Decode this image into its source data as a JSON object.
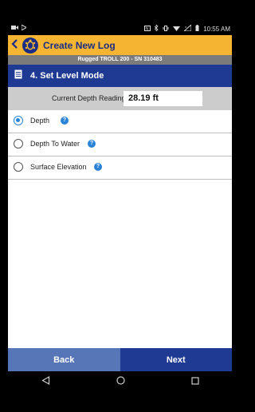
{
  "status_bar": {
    "time": "10:55 AM",
    "icons": [
      "video-icon",
      "play-icon",
      "nfc-icon",
      "bluetooth-icon",
      "vibrate-icon",
      "wifi-icon",
      "signal-icon",
      "battery-icon"
    ]
  },
  "app_bar": {
    "back_icon": "chevron-left-icon",
    "logo_icon": "turtle-logo-icon",
    "title": "Create New Log",
    "color": "#f5b431"
  },
  "device_bar": {
    "text": "Rugged TROLL 200 - SN 310483"
  },
  "step_bar": {
    "icon": "document-icon",
    "title": "4. Set Level Mode",
    "color": "#1f3a93"
  },
  "reading": {
    "label": "Current Depth Reading:",
    "value": "28.19 ft"
  },
  "options": [
    {
      "label": "Depth",
      "selected": true
    },
    {
      "label": "Depth To Water",
      "selected": false
    },
    {
      "label": "Surface Elevation",
      "selected": false
    }
  ],
  "help_glyph": "?",
  "footer": {
    "back_label": "Back",
    "next_label": "Next"
  },
  "nav_bar": {
    "icons": [
      "back-triangle-icon",
      "home-circle-icon",
      "recents-square-icon"
    ]
  }
}
